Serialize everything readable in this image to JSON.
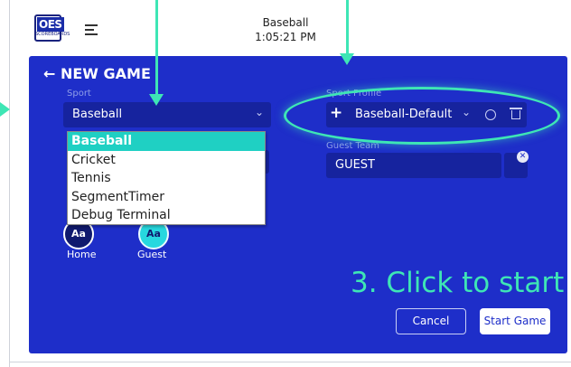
{
  "header": {
    "logo_text": "OES",
    "logo_subtext": "SCOREBOARDS",
    "title": "Baseball",
    "time": "1:05:21 PM"
  },
  "form": {
    "title": "← NEW GAME",
    "sport": {
      "label": "Sport",
      "value": "Baseball"
    },
    "sport_profile": {
      "label": "Sport Profile",
      "value": "Baseball-Default"
    },
    "guest_team": {
      "label": "Guest Team",
      "value": "GUEST"
    },
    "avatars": [
      {
        "text": "Aa",
        "caption": "Home"
      },
      {
        "text": "Aa",
        "caption": "Guest"
      }
    ],
    "buttons": {
      "cancel": "Cancel",
      "start": "Start Game"
    }
  },
  "dropdown": {
    "options": [
      "Baseball",
      "Cricket",
      "Tennis",
      "SegmentTimer",
      "Debug Terminal"
    ],
    "selected": "Baseball"
  },
  "annotation": {
    "hint": "3. Click to start",
    "color": "#3ee6b5"
  },
  "colors": {
    "panel": "#1e2ec9",
    "field": "#16239e",
    "accent": "#1fd0c3"
  }
}
